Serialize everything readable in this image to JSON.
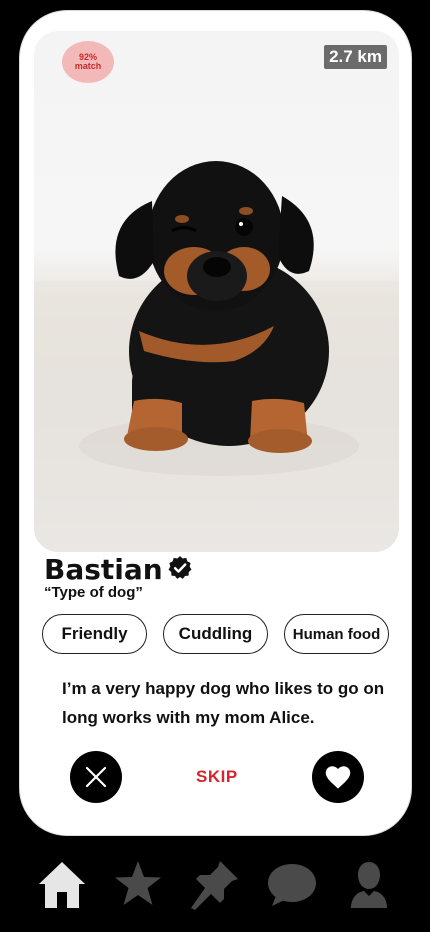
{
  "profile": {
    "match_percent": "92%",
    "match_label": "match",
    "distance": "2.7 km",
    "name": "Bastian",
    "type": "“Type of dog”",
    "tags": [
      "Friendly",
      "Cuddling",
      "Human food"
    ],
    "bio": "I’m a very happy dog who likes to go on long works with my mom Alice.",
    "verified": true
  },
  "actions": {
    "reject_icon": "close-icon",
    "skip_label": "SKIP",
    "like_icon": "heart-icon"
  },
  "tabbar": {
    "items": [
      {
        "icon": "home-icon",
        "active": true
      },
      {
        "icon": "star-icon",
        "active": false
      },
      {
        "icon": "pin-icon",
        "active": false
      },
      {
        "icon": "chat-icon",
        "active": false
      },
      {
        "icon": "person-icon",
        "active": false
      }
    ]
  },
  "colors": {
    "background": "#000000",
    "card": "#ffffff",
    "accent_red": "#d4262c",
    "match_badge_bg": "#f3b9b9",
    "tab_active": "#e6e6e6",
    "tab_inactive": "#4a4a4a"
  }
}
